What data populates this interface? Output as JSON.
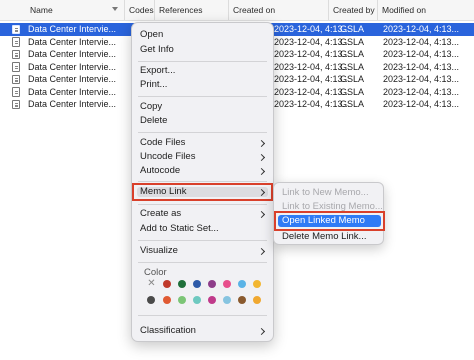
{
  "table": {
    "columns": {
      "name": "Name",
      "codes": "Codes",
      "references": "References",
      "created_on": "Created on",
      "created_by": "Created by",
      "modified_on": "Modified on"
    },
    "rows": [
      {
        "name": "Data Center Intervie...",
        "created_on": "2023-12-04, 4:13...",
        "created_by": "GSLA",
        "modified_on": "2023-12-04, 4:13..."
      },
      {
        "name": "Data Center Intervie...",
        "created_on": "2023-12-04, 4:13...",
        "created_by": "GSLA",
        "modified_on": "2023-12-04, 4:13..."
      },
      {
        "name": "Data Center Intervie...",
        "created_on": "2023-12-04, 4:13...",
        "created_by": "GSLA",
        "modified_on": "2023-12-04, 4:13..."
      },
      {
        "name": "Data Center Intervie...",
        "created_on": "2023-12-04, 4:13...",
        "created_by": "GSLA",
        "modified_on": "2023-12-04, 4:13..."
      },
      {
        "name": "Data Center Intervie...",
        "created_on": "2023-12-04, 4:13...",
        "created_by": "GSLA",
        "modified_on": "2023-12-04, 4:13..."
      },
      {
        "name": "Data Center Intervie...",
        "created_on": "2023-12-04, 4:13...",
        "created_by": "GSLA",
        "modified_on": "2023-12-04, 4:13..."
      },
      {
        "name": "Data Center Intervie...",
        "created_on": "2023-12-04, 4:13...",
        "created_by": "GSLA",
        "modified_on": "2023-12-04, 4:13..."
      }
    ]
  },
  "context_menu": {
    "open": "Open",
    "get_info": "Get Info",
    "export": "Export...",
    "print": "Print...",
    "copy": "Copy",
    "delete": "Delete",
    "code_files": "Code Files",
    "uncode_files": "Uncode Files",
    "autocode": "Autocode",
    "memo_link": "Memo Link",
    "create_as": "Create as",
    "add_to_static_set": "Add to Static Set...",
    "visualize": "Visualize",
    "color_label": "Color",
    "classification": "Classification",
    "colors_row1": [
      "#c0392b",
      "#1f6f3a",
      "#2e5aa8",
      "#8e3d8a",
      "#e84f8c",
      "#5ab3e6",
      "#f2b630"
    ],
    "colors_row2": [
      "#4a4a4a",
      "#e05a33",
      "#7cc576",
      "#6ec9c0",
      "#c03a8b",
      "#86c4e0",
      "#8a5a2e",
      "#f0a830"
    ]
  },
  "submenu": {
    "link_to_new": "Link to New Memo...",
    "link_to_existing": "Link to Existing Memo...",
    "open_linked": "Open Linked Memo",
    "delete_link": "Delete Memo Link..."
  }
}
